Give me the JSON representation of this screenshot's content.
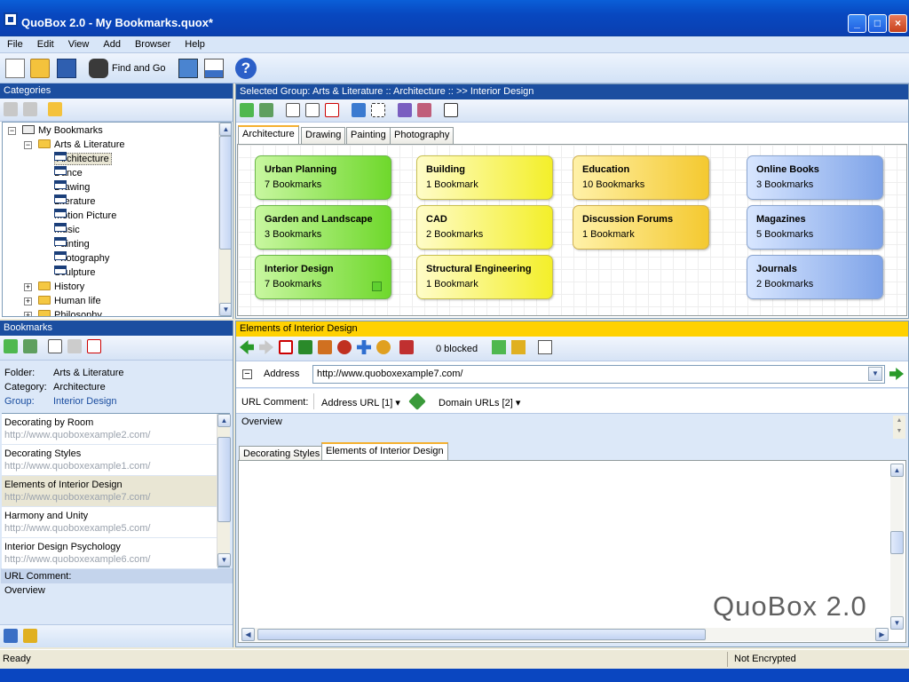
{
  "window": {
    "title": "QuoBox 2.0 - My Bookmarks.quox*"
  },
  "menu": [
    "File",
    "Edit",
    "View",
    "Add",
    "Browser",
    "Help"
  ],
  "toolbar": {
    "find_label": "Find and Go"
  },
  "categories": {
    "header": "Categories",
    "tree": [
      {
        "label": "My Bookmarks",
        "level": 0,
        "kind": "book",
        "exp": "−"
      },
      {
        "label": "Arts & Literature",
        "level": 1,
        "kind": "fold",
        "exp": "−"
      },
      {
        "label": "Architecture",
        "level": 2,
        "kind": "tab",
        "selected": true
      },
      {
        "label": "Dance",
        "level": 2,
        "kind": "tab"
      },
      {
        "label": "Drawing",
        "level": 2,
        "kind": "tab"
      },
      {
        "label": "Literature",
        "level": 2,
        "kind": "tab"
      },
      {
        "label": "Motion Picture",
        "level": 2,
        "kind": "tab"
      },
      {
        "label": "Music",
        "level": 2,
        "kind": "tab"
      },
      {
        "label": "Painting",
        "level": 2,
        "kind": "tab"
      },
      {
        "label": "Photography",
        "level": 2,
        "kind": "tab"
      },
      {
        "label": "Sculpture",
        "level": 2,
        "kind": "tab"
      },
      {
        "label": "History",
        "level": 1,
        "kind": "fold",
        "exp": "+"
      },
      {
        "label": "Human life",
        "level": 1,
        "kind": "fold",
        "exp": "+"
      },
      {
        "label": "Philosophy",
        "level": 1,
        "kind": "fold",
        "exp": "+"
      }
    ]
  },
  "group": {
    "header": "Selected Group:   Arts & Literature  :: Architecture ::  >>  Interior Design",
    "tabs": [
      "Architecture",
      "Drawing",
      "Painting",
      "Photography"
    ],
    "cards": [
      {
        "name": "Urban Planning",
        "count": "7 Bookmarks",
        "color": "green"
      },
      {
        "name": "Garden and Landscape",
        "count": "3 Bookmarks",
        "color": "green"
      },
      {
        "name": "Interior Design",
        "count": "7 Bookmarks",
        "color": "green"
      },
      {
        "name": "Building",
        "count": "1 Bookmark",
        "color": "yellow"
      },
      {
        "name": "CAD",
        "count": "2 Bookmarks",
        "color": "yellow"
      },
      {
        "name": "Structural Engineering",
        "count": "1 Bookmark",
        "color": "yellow"
      },
      {
        "name": "Education",
        "count": "10 Bookmarks",
        "color": "orange"
      },
      {
        "name": "Discussion Forums",
        "count": "1 Bookmark",
        "color": "orange"
      },
      {
        "name": "Online Books",
        "count": "3 Bookmarks",
        "color": "blue"
      },
      {
        "name": "Magazines",
        "count": "5 Bookmarks",
        "color": "blue"
      },
      {
        "name": "Journals",
        "count": "2 Bookmarks",
        "color": "blue"
      }
    ]
  },
  "bookmarks": {
    "header": "Bookmarks",
    "folder_label": "Folder:",
    "folder_value": "Arts & Literature",
    "category_label": "Category:",
    "category_value": "Architecture",
    "group_label": "Group:",
    "group_value": "Interior Design",
    "items": [
      {
        "title": "Decorating by Room",
        "url": "http://www.quoboxexample2.com/"
      },
      {
        "title": "Decorating Styles",
        "url": "http://www.quoboxexample1.com/"
      },
      {
        "title": "Elements of Interior Design",
        "url": "http://www.quoboxexample7.com/",
        "selected": true
      },
      {
        "title": "Harmony and Unity",
        "url": "http://www.quoboxexample5.com/"
      },
      {
        "title": "Interior Design Psychology",
        "url": "http://www.quoboxexample6.com/"
      }
    ],
    "comment_label": "URL Comment:",
    "comment_value": "Overview"
  },
  "browser": {
    "header": "Elements of Interior Design",
    "blocked": "0 blocked",
    "address_label": "Address",
    "address_value": "http://www.quoboxexample7.com/",
    "url_comment_label": "URL Comment:",
    "address_url_label": "Address URL [1]",
    "domain_urls_label": "Domain URLs [2]",
    "comment_text": "Overview",
    "tabs": [
      "Decorating Styles",
      "Elements of Interior Design"
    ],
    "watermark": "QuoBox 2.0"
  },
  "status": {
    "left": "Ready",
    "right": "Not Encrypted"
  }
}
